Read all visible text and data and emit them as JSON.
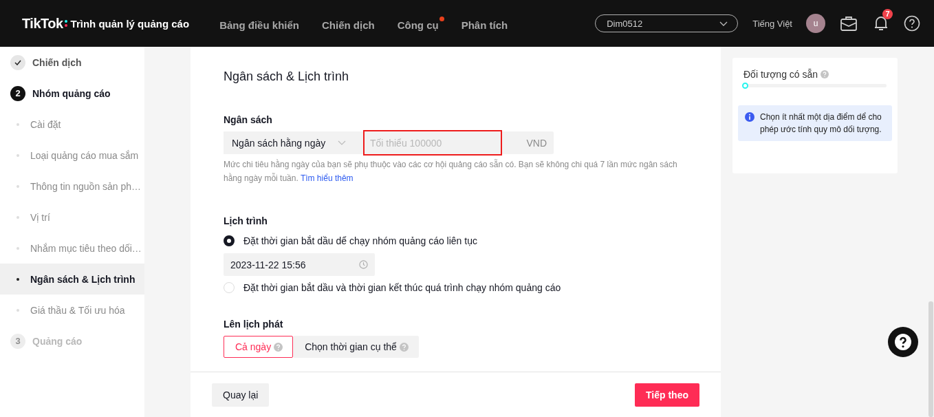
{
  "header": {
    "logo": "TikTok",
    "app_name": "Trình quản lý quảng cáo",
    "nav": [
      {
        "label": "Bảng điều khiển",
        "dot": false
      },
      {
        "label": "Chiến dịch",
        "dot": false
      },
      {
        "label": "Công cụ",
        "dot": true
      },
      {
        "label": "Phân tích",
        "dot": false
      }
    ],
    "account": "Dim0512",
    "language": "Tiếng Việt",
    "avatar": "u",
    "notification_count": "7"
  },
  "sidebar": {
    "steps": [
      {
        "label": "Chiến dịch",
        "done": true,
        "current": false
      },
      {
        "number": "2",
        "label": "Nhóm quảng cáo",
        "done": false,
        "current": true,
        "children": [
          {
            "label": "Cài đặt",
            "selected": false
          },
          {
            "label": "Loại quảng cáo mua sắm",
            "selected": false
          },
          {
            "label": "Thông tin nguồn sản ph…",
            "selected": false
          },
          {
            "label": "Vị trí",
            "selected": false
          },
          {
            "label": "Nhắm mục tiêu theo dối…",
            "selected": false
          },
          {
            "label": "Ngân sách & Lịch trình",
            "selected": true
          },
          {
            "label": "Giá thầu & Tối ưu hóa",
            "selected": false
          }
        ]
      },
      {
        "number": "3",
        "label": "Quảng cáo",
        "done": false,
        "current": false
      }
    ]
  },
  "content": {
    "title": "Ngân sách & Lịch trình",
    "budget": {
      "label": "Ngân sách",
      "type": "Ngân sách hằng ngày",
      "placeholder": "Tối thiểu 100000",
      "currency": "VND",
      "highlighted": true,
      "help": "Mức chi tiêu hằng ngày của bạn sẽ phụ thuộc vào các cơ hội quảng cáo sẵn có. Bạn sẽ không chi quá 7 lần mức ngân sách hằng ngày mỗi tuần.",
      "link": "Tìm hiểu thêm"
    },
    "schedule": {
      "label": "Lịch trình",
      "options": [
        {
          "label": "Đặt thời gian bắt dầu dể chạy nhóm quảng cáo liên tục",
          "selected": true,
          "date": "2023-11-22 15:56"
        },
        {
          "label": "Đặt thời gian bắt dầu và thời gian kết thúc quá trình chạy nhóm quảng cáo",
          "selected": false
        }
      ]
    },
    "dayparting": {
      "label": "Lên lịch phát",
      "options": [
        {
          "label": "Cả ngày",
          "selected": true
        },
        {
          "label": "Chọn thời gian cụ thể",
          "selected": false
        }
      ]
    },
    "back": "Quay lại",
    "next": "Tiếp theo"
  },
  "audience": {
    "title": "Đối tượng có sẵn",
    "level": 0,
    "info": "Chọn ít nhất một dịa điểm dể cho phép ước tính quy mô dối tượng."
  }
}
